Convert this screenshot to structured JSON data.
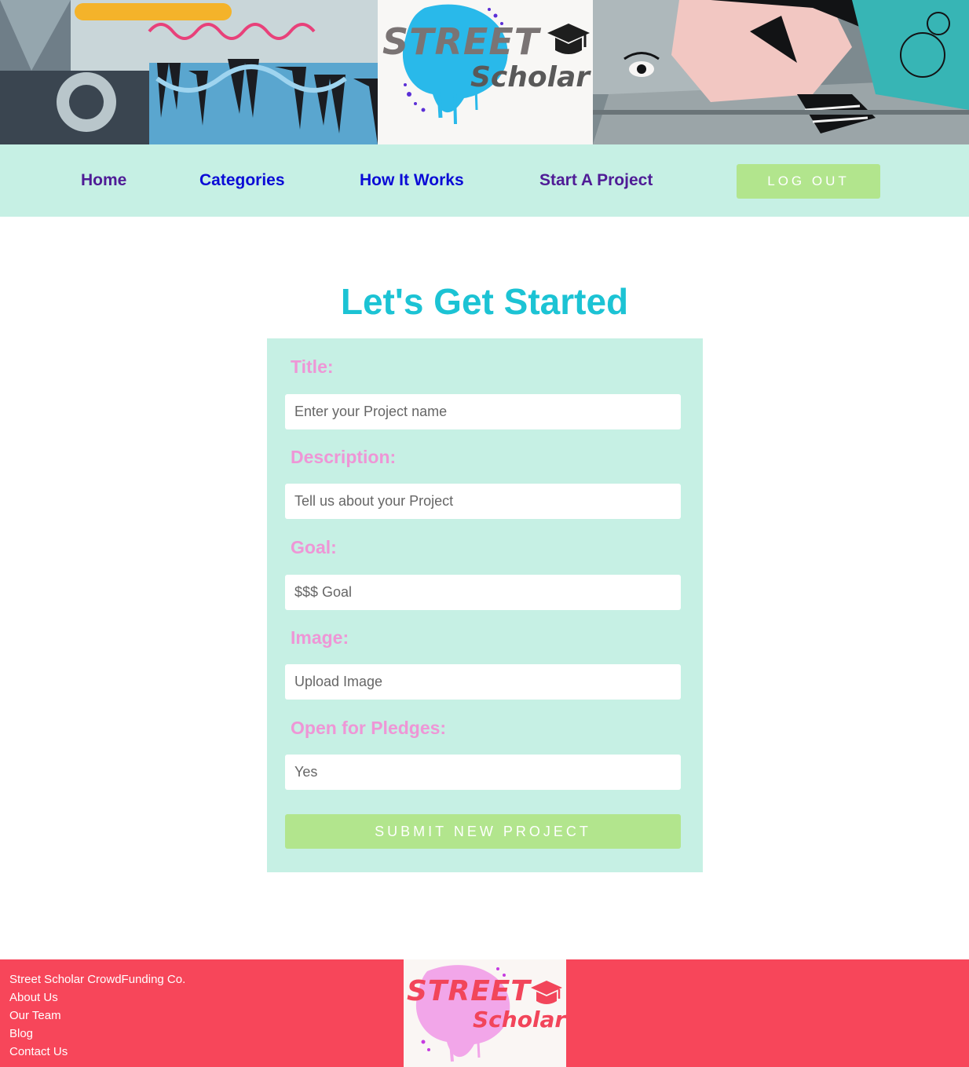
{
  "brand": {
    "logo_line1": "STREET",
    "logo_line2": "Scholar",
    "icon": "graduation-cap-icon"
  },
  "nav": {
    "items": [
      {
        "label": "Home"
      },
      {
        "label": "Categories"
      },
      {
        "label": "How It Works"
      },
      {
        "label": "Start A Project"
      }
    ],
    "logout_label": "LOG OUT"
  },
  "form": {
    "heading": "Let's Get Started",
    "fields": [
      {
        "label": "Title:",
        "placeholder": "Enter your Project name"
      },
      {
        "label": "Description:",
        "placeholder": "Tell us about your Project"
      },
      {
        "label": "Goal:",
        "placeholder": "$$$ Goal"
      },
      {
        "label": "Image:",
        "placeholder": "Upload Image"
      },
      {
        "label": "Open for Pledges:",
        "placeholder": "Yes"
      }
    ],
    "submit_label": "SUBMIT NEW PROJECT"
  },
  "footer": {
    "company": "Street Scholar CrowdFunding Co.",
    "links": [
      "About Us",
      "Our Team",
      "Blog",
      "Contact Us"
    ]
  },
  "colors": {
    "accent_teal": "#1cc3d4",
    "nav_bg": "#c6f0e4",
    "label_pink": "#ee96d6",
    "button_green": "#b2e58d",
    "footer_red": "#f7465a",
    "nav_link_purple": "#4f1c96",
    "nav_link_blue": "#0b0bd6"
  }
}
